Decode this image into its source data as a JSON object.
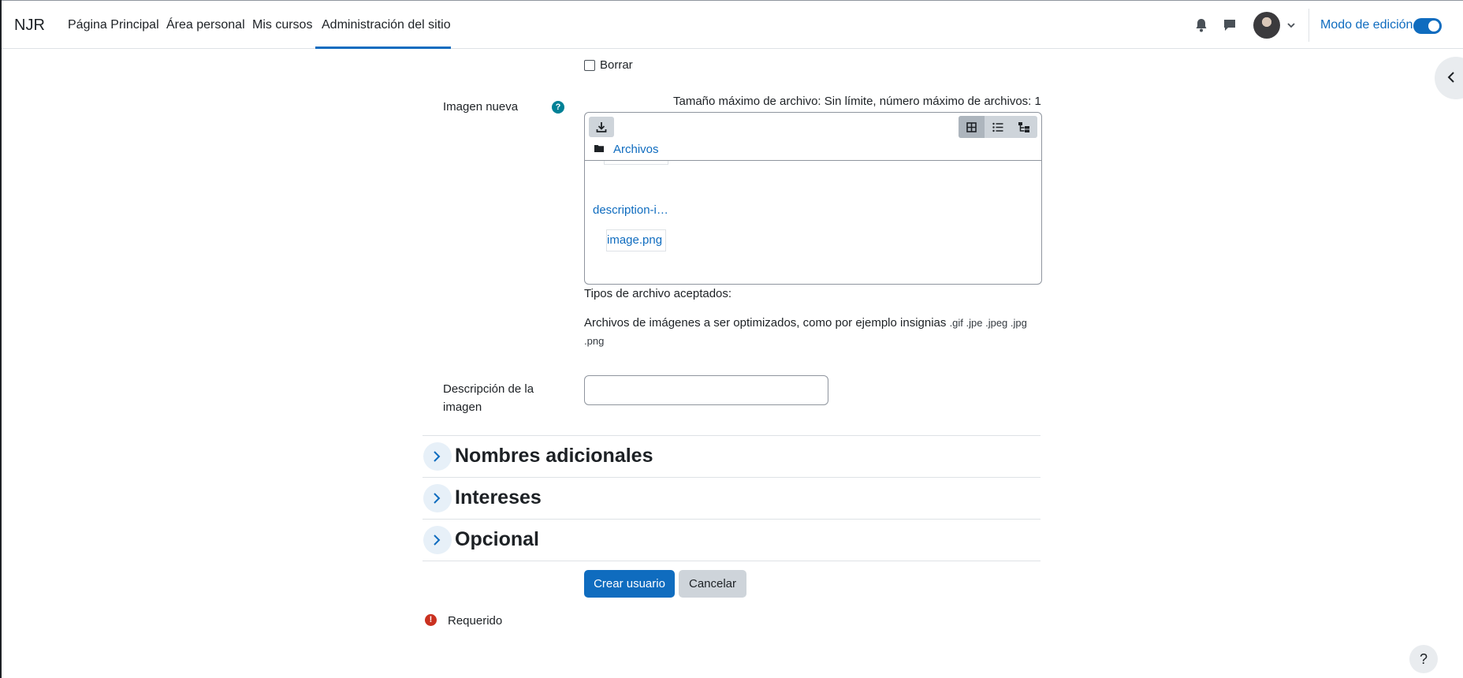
{
  "navbar": {
    "brand": "NJR",
    "items": [
      {
        "label": "Página Principal"
      },
      {
        "label": "Área personal"
      },
      {
        "label": "Mis cursos"
      },
      {
        "label": "Administración del sitio",
        "active": true
      }
    ],
    "icons": [
      "bell-icon",
      "message-icon",
      "avatar",
      "chevron-down-icon"
    ],
    "edit_mode_label": "Modo de edición",
    "edit_mode_on": true
  },
  "form": {
    "delete_checkbox_label": "Borrar",
    "new_image_label": "Imagen nueva",
    "filepicker": {
      "limits": "Tamaño máximo de archivo: Sin límite, número máximo de archivos: 1",
      "path": "Archivos",
      "files": [
        "description-i…",
        "image.png"
      ],
      "view_modes": [
        "grid-icon",
        "list-icon",
        "tree-icon"
      ]
    },
    "accepted_types_label": "Tipos de archivo aceptados:",
    "accepted_types_desc": "Archivos de imágenes a ser optimizados, como por ejemplo insignias",
    "accepted_types_ext_line1": ".gif .jpe .jpeg .jpg",
    "accepted_types_ext_line2": ".png",
    "image_description_label_line1": "Descripción de la",
    "image_description_label_line2": "imagen",
    "image_description_value": ""
  },
  "sections": [
    {
      "title": "Nombres adicionales"
    },
    {
      "title": "Intereses"
    },
    {
      "title": "Opcional"
    }
  ],
  "buttons": {
    "create": "Crear usuario",
    "cancel": "Cancelar"
  },
  "required_label": "Requerido",
  "help_label": "?",
  "colors": {
    "primary": "#0f6cbf",
    "required": "#ca3120",
    "help": "#008196"
  }
}
